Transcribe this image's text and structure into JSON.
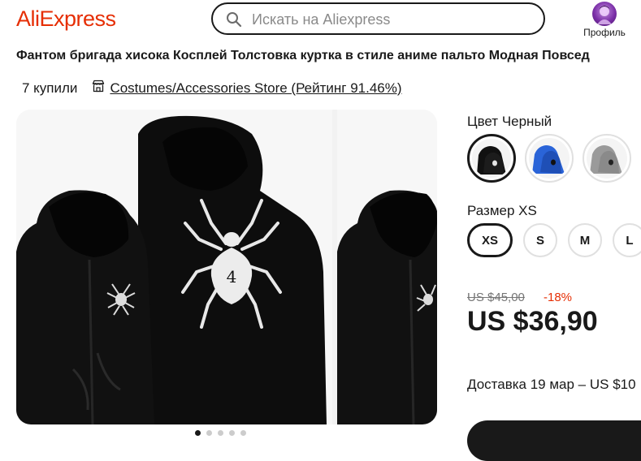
{
  "header": {
    "logo": "AliExpress",
    "search_placeholder": "Искать на Aliexpress",
    "profile_label": "Профиль"
  },
  "product": {
    "title": "Фантом бригада хисока Косплей Толстовка куртка в стиле аниме пальто Модная Повсед",
    "sold": "7 купили",
    "store": "Costumes/Accessories Store (Рейтинг 91.46%)"
  },
  "gallery": {
    "print_number": "4",
    "dots_count": 5,
    "active_dot": 0
  },
  "options": {
    "color_label": "Цвет Черный",
    "colors": [
      {
        "name": "black-hoodie",
        "hex": "#1a1a1a",
        "selected": true
      },
      {
        "name": "blue-hoodie",
        "hex": "#2a64d8",
        "selected": false
      },
      {
        "name": "gray-hoodie",
        "hex": "#9a9a9a",
        "selected": false
      }
    ],
    "size_label": "Размер XS",
    "sizes": [
      {
        "label": "XS",
        "selected": true
      },
      {
        "label": "S",
        "selected": false
      },
      {
        "label": "M",
        "selected": false
      },
      {
        "label": "L",
        "selected": false
      }
    ]
  },
  "pricing": {
    "old_price": "US $45,00",
    "discount": "-18%",
    "price": "US $36,90"
  },
  "delivery": {
    "text": "Доставка 19 мар – US $10"
  },
  "colors": {
    "brand": "#e62e04",
    "text": "#191919",
    "discount": "#e62e04"
  }
}
